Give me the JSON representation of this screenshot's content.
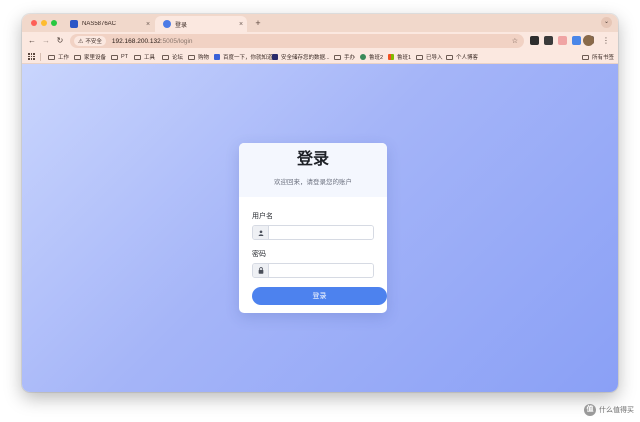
{
  "browser": {
    "tabs": [
      {
        "title": "NAS5876AC",
        "close": "×"
      },
      {
        "title": "登录",
        "close": "×"
      }
    ],
    "new_tab": "+",
    "menu": "⌄",
    "nav": {
      "back": "←",
      "forward": "→",
      "reload": "↻"
    },
    "security_label": "不安全",
    "url_host": "192.168.200.132",
    "url_path": ":5005/login",
    "bookmark_star": "☆",
    "kebab": "⋮"
  },
  "bookmarks": {
    "items": [
      "工作",
      "家里设备",
      "PT",
      "工具",
      "论坛",
      "购物",
      "百度一下，你就知道",
      "安全储存您的数据...",
      "手办",
      "鲁班2",
      "鲁班1",
      "已导入",
      "个人博客"
    ],
    "all": "所有书签"
  },
  "login": {
    "title": "登录",
    "subtitle": "欢迎回来，请登录您的账户",
    "username_label": "用户名",
    "username_value": "",
    "password_label": "密码",
    "password_value": "",
    "submit_label": "登录"
  },
  "watermark": {
    "badge": "值",
    "text": "什么值得买"
  },
  "colors": {
    "accent": "#4d82ee",
    "tabstrip": "#f1d8cb",
    "toolbar": "#fbe8e0",
    "gradient_start": "#c9d5fd",
    "gradient_end": "#8aa0f6"
  }
}
